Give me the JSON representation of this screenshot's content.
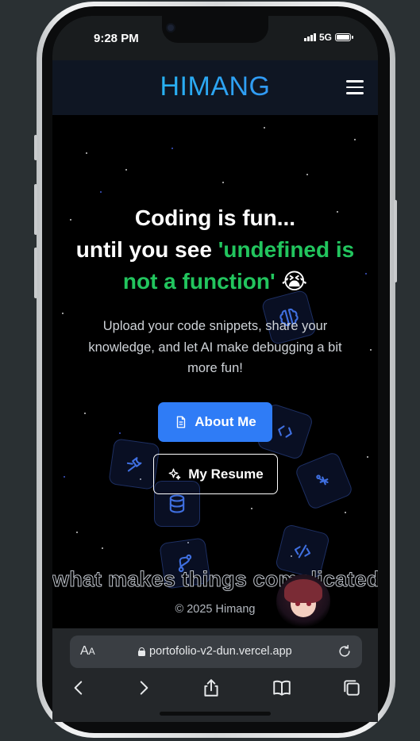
{
  "status_bar": {
    "time": "9:28 PM",
    "network": "5G"
  },
  "header": {
    "logo": "HIMANG",
    "menu_icon": "hamburger-menu-icon"
  },
  "hero": {
    "line1": "Coding is fun...",
    "line2_prefix": "until you see ",
    "highlight_part1": "'undefined is",
    "highlight_part2": "not a function'",
    "emoji": "😭",
    "subtext": "Upload your code snippets, share your knowledge, and let AI make debugging a bit more fun!"
  },
  "buttons": {
    "about_label": "About Me",
    "resume_label": "My Resume"
  },
  "marquee_text": "what makes things complicated",
  "footer": {
    "copyright": "© 2025 Himang"
  },
  "browser": {
    "aa_label": "AA",
    "url": "portofolio-v2-dun.vercel.app"
  },
  "colors": {
    "accent_green": "#22c55e",
    "primary_blue": "#2f7cf6",
    "logo_gradient_start": "#1ec8ef",
    "logo_gradient_end": "#3b82f6",
    "page_background": "#000000"
  },
  "floating_icons": [
    "brain-icon",
    "code-brackets-icon",
    "wrench-icon",
    "database-icon",
    "cpu-icon",
    "git-branch-icon",
    "code-slash-icon"
  ]
}
